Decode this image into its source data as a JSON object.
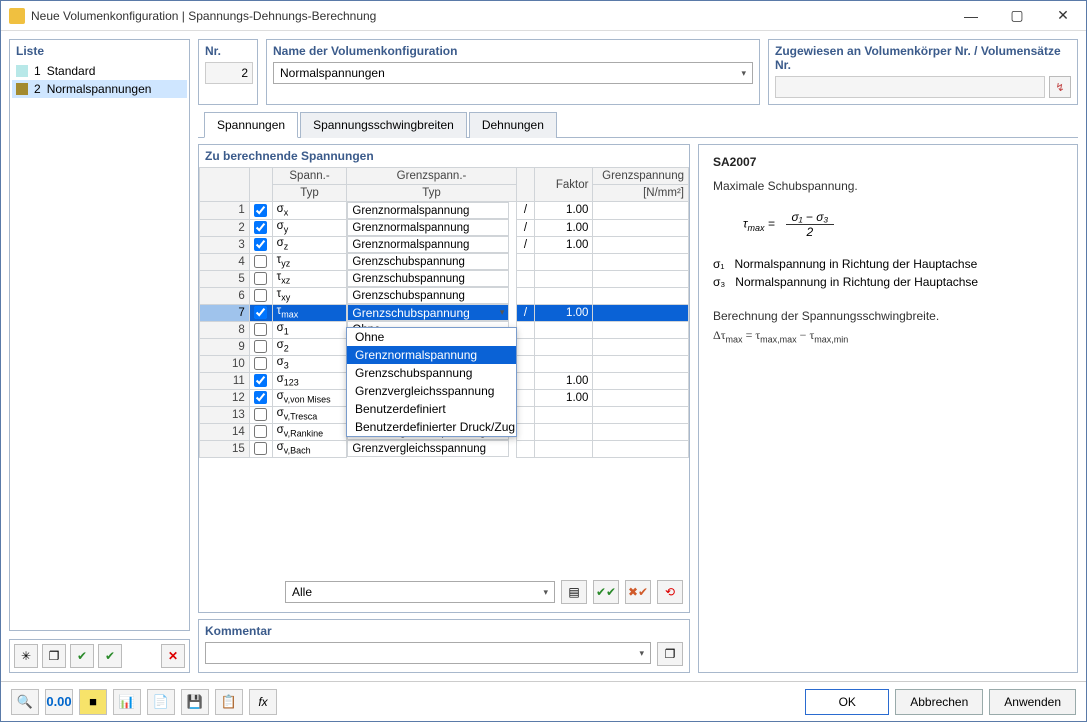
{
  "window": {
    "title": "Neue Volumenkonfiguration | Spannungs-Dehnungs-Berechnung"
  },
  "left": {
    "title": "Liste",
    "items": [
      {
        "num": "1",
        "label": "Standard",
        "swatch": "#b8e8e8",
        "selected": false
      },
      {
        "num": "2",
        "label": "Normalspannungen",
        "swatch": "#a38a2f",
        "selected": true
      }
    ]
  },
  "top": {
    "nr_label": "Nr.",
    "nr_value": "2",
    "name_label": "Name der Volumenkonfiguration",
    "name_value": "Normalspannungen",
    "assigned_label": "Zugewiesen an Volumenkörper Nr. / Volumensätze Nr."
  },
  "tabs": [
    {
      "label": "Spannungen",
      "active": true
    },
    {
      "label": "Spannungsschwingbreiten",
      "active": false
    },
    {
      "label": "Dehnungen",
      "active": false
    }
  ],
  "grid": {
    "title": "Zu berechnende Spannungen",
    "columns": {
      "spann1": "Spann.-",
      "spann2": "Typ",
      "grenz1": "Grenzspann.-",
      "grenz2": "Typ",
      "faktor": "Faktor",
      "limit1": "Grenzspannung",
      "limit2": "[N/mm²]"
    },
    "rows": [
      {
        "n": "1",
        "chk": true,
        "typ": "σ<sub>x</sub>",
        "grenz": "Grenznormalspannung",
        "slash": "/",
        "faktor": "1.00",
        "lim": ""
      },
      {
        "n": "2",
        "chk": true,
        "typ": "σ<sub>y</sub>",
        "grenz": "Grenznormalspannung",
        "slash": "/",
        "faktor": "1.00",
        "lim": ""
      },
      {
        "n": "3",
        "chk": true,
        "typ": "σ<sub>z</sub>",
        "grenz": "Grenznormalspannung",
        "slash": "/",
        "faktor": "1.00",
        "lim": ""
      },
      {
        "n": "4",
        "chk": false,
        "typ": "τ<sub>yz</sub>",
        "grenz": "Grenzschubspannung",
        "slash": "",
        "faktor": "",
        "lim": ""
      },
      {
        "n": "5",
        "chk": false,
        "typ": "τ<sub>xz</sub>",
        "grenz": "Grenzschubspannung",
        "slash": "",
        "faktor": "",
        "lim": ""
      },
      {
        "n": "6",
        "chk": false,
        "typ": "τ<sub>xy</sub>",
        "grenz": "Grenzschubspannung",
        "slash": "",
        "faktor": "",
        "lim": ""
      },
      {
        "n": "7",
        "chk": true,
        "typ": "τ<sub>max</sub>",
        "grenz": "Grenzschubspannung",
        "slash": "/",
        "faktor": "1.00",
        "lim": "",
        "selected": true,
        "dropdown": true
      },
      {
        "n": "8",
        "chk": false,
        "typ": "σ<sub>1</sub>",
        "grenz": "Ohne",
        "slash": "",
        "faktor": "",
        "lim": ""
      },
      {
        "n": "9",
        "chk": false,
        "typ": "σ<sub>2</sub>",
        "grenz": "Grenznormalspannung",
        "slash": "",
        "faktor": "",
        "lim": "",
        "dditem_sel": true
      },
      {
        "n": "10",
        "chk": false,
        "typ": "σ<sub>3</sub>",
        "grenz": "Grenzschubspannung",
        "slash": "",
        "faktor": "",
        "lim": ""
      },
      {
        "n": "11",
        "chk": true,
        "typ": "σ<sub>123</sub>",
        "grenz": "Grenzvergleichsspannung",
        "slash": "",
        "faktor": "1.00",
        "lim": ""
      },
      {
        "n": "12",
        "chk": true,
        "typ": "σ<sub>v,von Mises</sub>",
        "grenz": "Benutzerdefiniert",
        "slash": "",
        "faktor": "1.00",
        "lim": ""
      },
      {
        "n": "13",
        "chk": false,
        "typ": "σ<sub>v,Tresca</sub>",
        "grenz": "Benutzerdefinierter Druck/Zug",
        "slash": "",
        "faktor": "",
        "lim": ""
      },
      {
        "n": "14",
        "chk": false,
        "typ": "σ<sub>v,Rankine</sub>",
        "grenz": "Grenzvergleichsspannung",
        "slash": "",
        "faktor": "",
        "lim": ""
      },
      {
        "n": "15",
        "chk": false,
        "typ": "σ<sub>v,Bach</sub>",
        "grenz": "Grenzvergleichsspannung",
        "slash": "",
        "faktor": "",
        "lim": ""
      }
    ],
    "dropdown_options": [
      "Ohne",
      "Grenznormalspannung",
      "Grenzschubspannung",
      "Grenzvergleichsspannung",
      "Benutzerdefiniert",
      "Benutzerdefinierter Druck/Zug"
    ],
    "dropdown_selected_index": 1,
    "footer_filter": "Alle"
  },
  "comment": {
    "title": "Kommentar",
    "value": ""
  },
  "info": {
    "code": "SA2007",
    "heading": "Maximale Schubspannung.",
    "formula_lhs": "τ",
    "formula_sub": "max",
    "formula_num": "σ₁ − σ₃",
    "formula_den": "2",
    "sigma1_sym": "σ₁",
    "sigma1_txt": "Normalspannung in Richtung der Hauptachse",
    "sigma3_sym": "σ₃",
    "sigma3_txt": "Normalspannung in Richtung der Hauptachse",
    "swing_label": "Berechnung der Spannungsschwingbreite.",
    "swing_formula": "Δτ_max = τ_max,max − τ_max,min"
  },
  "buttons": {
    "ok": "OK",
    "cancel": "Abbrechen",
    "apply": "Anwenden"
  }
}
